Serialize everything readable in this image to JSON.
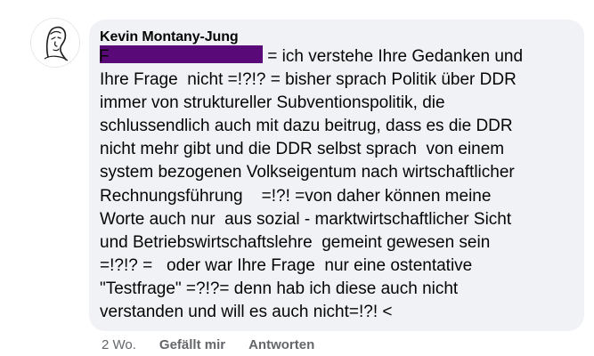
{
  "comment": {
    "author": "Kevin Montany-Jung",
    "text_first_line_rest": " = ich verstehe Ihre Gedanken und",
    "text_body": "Ihre Frage  nicht =!?!? = bisher sprach Politik über DDR\nimmer von struktureller Subventionspolitik, die\nschlussendlich auch mit dazu beitrug, dass es die DDR\nnicht mehr gibt und die DDR selbst sprach  von einem\nsystem bezogenen Volkseigentum nach wirtschaftlicher\nRechnungsführung    =!?! =von daher können meine\nWorte auch nur  aus sozial - marktwirtschaftlicher Sicht\nund Betriebswirtschaftslehre  gemeint gewesen sein\n=!?!? =   oder war Ihre Frage  nur eine ostentative\n\"Testfrage\" =?!?= denn hab ich diese auch nicht\nverstanden und will es auch nicht=!?! <",
    "redaction_color": "#5a0a78"
  },
  "actions": {
    "time": "2 Wo.",
    "like_label": "Gefällt mir",
    "reply_label": "Antworten"
  },
  "icons": {
    "avatar": "profile-sketch-avatar"
  }
}
